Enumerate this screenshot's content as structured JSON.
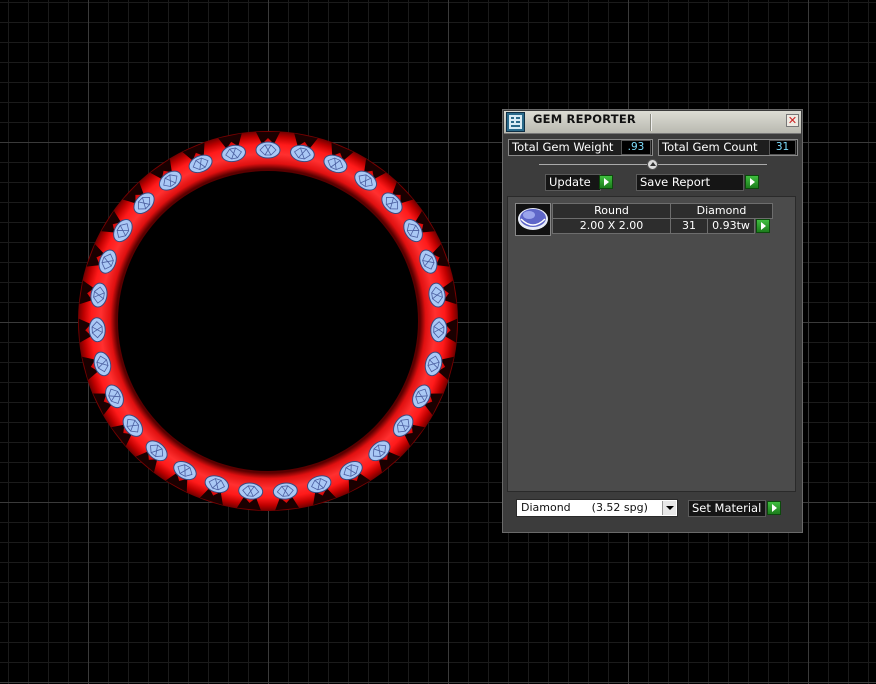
{
  "window": {
    "title": "GEM REPORTER",
    "close_glyph": "✕"
  },
  "totals": {
    "weight_label": "Total Gem Weight",
    "weight_value": ".93",
    "count_label": "Total Gem Count",
    "count_value": "31"
  },
  "actions": {
    "update_label": "Update",
    "save_report_label": "Save Report",
    "set_material_label": "Set Material"
  },
  "gem_rows": [
    {
      "shape": "Round",
      "size": "2.00 X 2.00",
      "material": "Diamond",
      "count": "31",
      "weight": "0.93tw",
      "icon": "round-gem-icon"
    }
  ],
  "material_select": {
    "selected": "Diamond      (3.52 spg)"
  },
  "colors": {
    "ring": "#ff1a1a",
    "gem": "#aac8f5",
    "panel": "#3c3c3c",
    "accent_value": "#7fdfff",
    "go_button": "#2ea62e"
  }
}
